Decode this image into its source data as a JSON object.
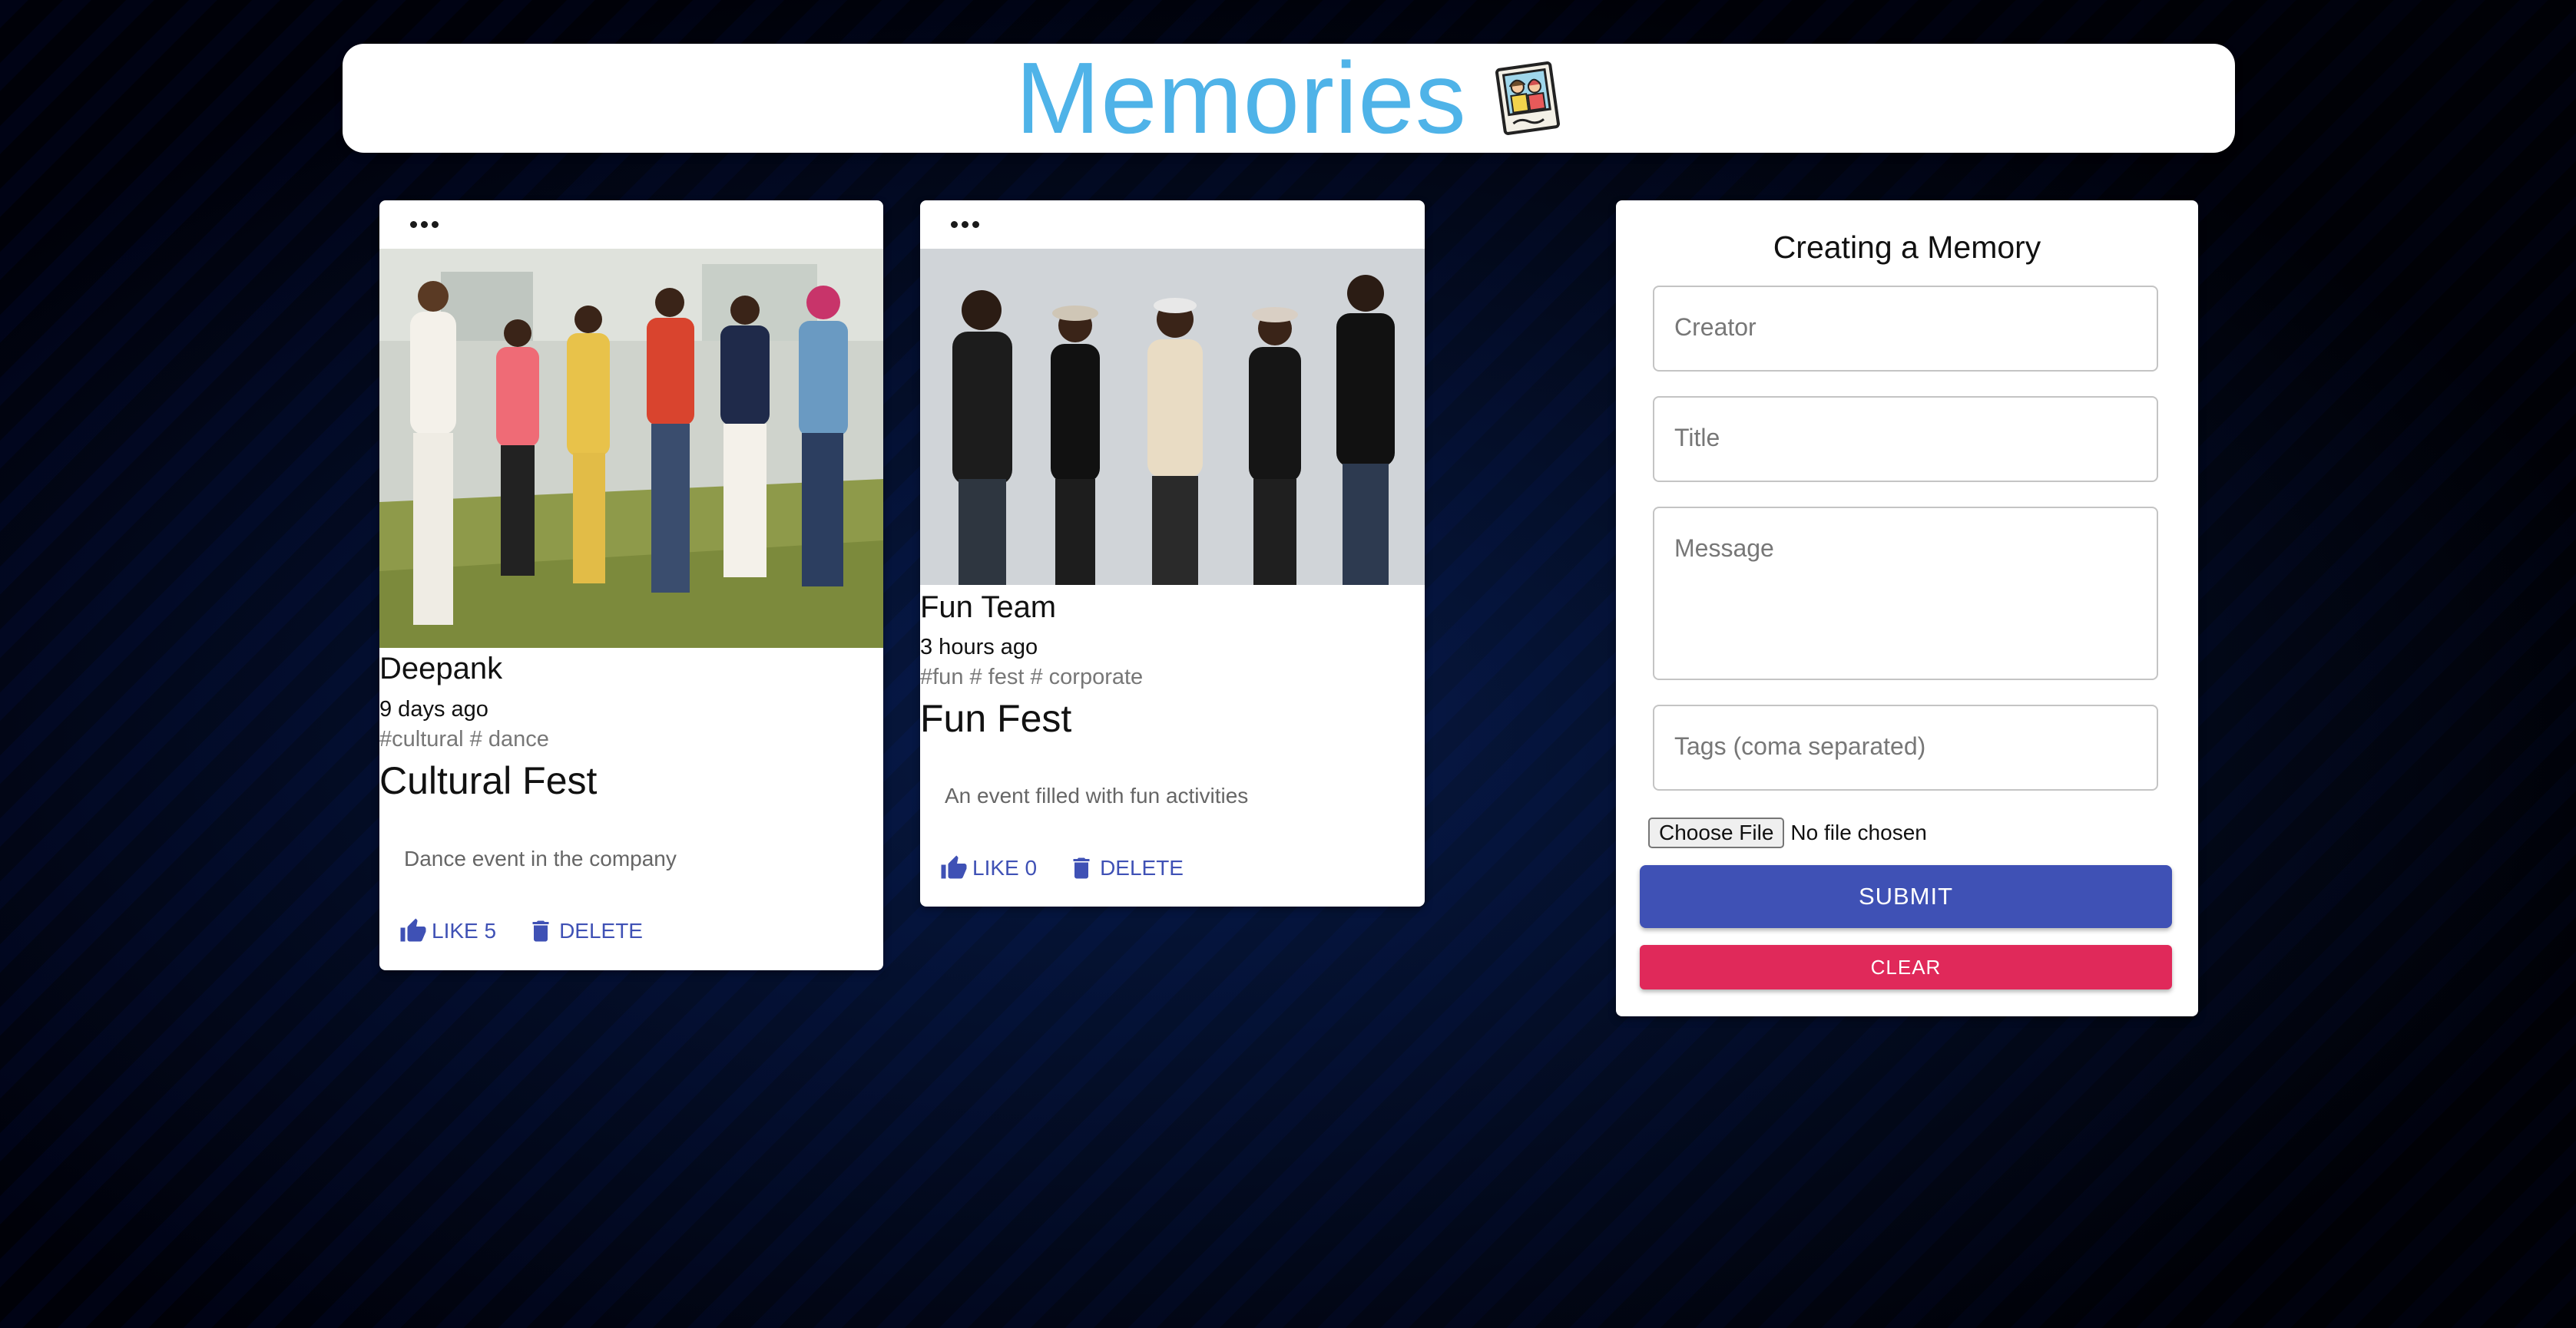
{
  "app": {
    "title": "Memories",
    "logo_icon": "memories-photo-icon"
  },
  "posts": [
    {
      "creator": "Deepank",
      "time": "9 days ago",
      "tags": "#cultural # dance",
      "title": "Cultural Fest",
      "message": "Dance event in the company",
      "like_label": "LIKE 5",
      "delete_label": "DELETE",
      "photo_description_icon": "group-photo-image"
    },
    {
      "creator": "Fun Team",
      "time": "3 hours ago",
      "tags": "#fun # fest # corporate",
      "title": "Fun Fest",
      "message": "An event filled with fun activities",
      "like_label": "LIKE 0",
      "delete_label": "DELETE",
      "photo_description_icon": "group-photo-image"
    }
  ],
  "form": {
    "heading": "Creating a Memory",
    "creator_placeholder": "Creator",
    "title_placeholder": "Title",
    "message_placeholder": "Message",
    "tags_placeholder": "Tags (coma separated)",
    "file_button": "Choose File",
    "file_status": "No file chosen",
    "submit_label": "SUBMIT",
    "clear_label": "CLEAR"
  },
  "colors": {
    "title_blue": "#4fb3e8",
    "primary": "#3f51b5",
    "secondary": "#e0295a"
  }
}
